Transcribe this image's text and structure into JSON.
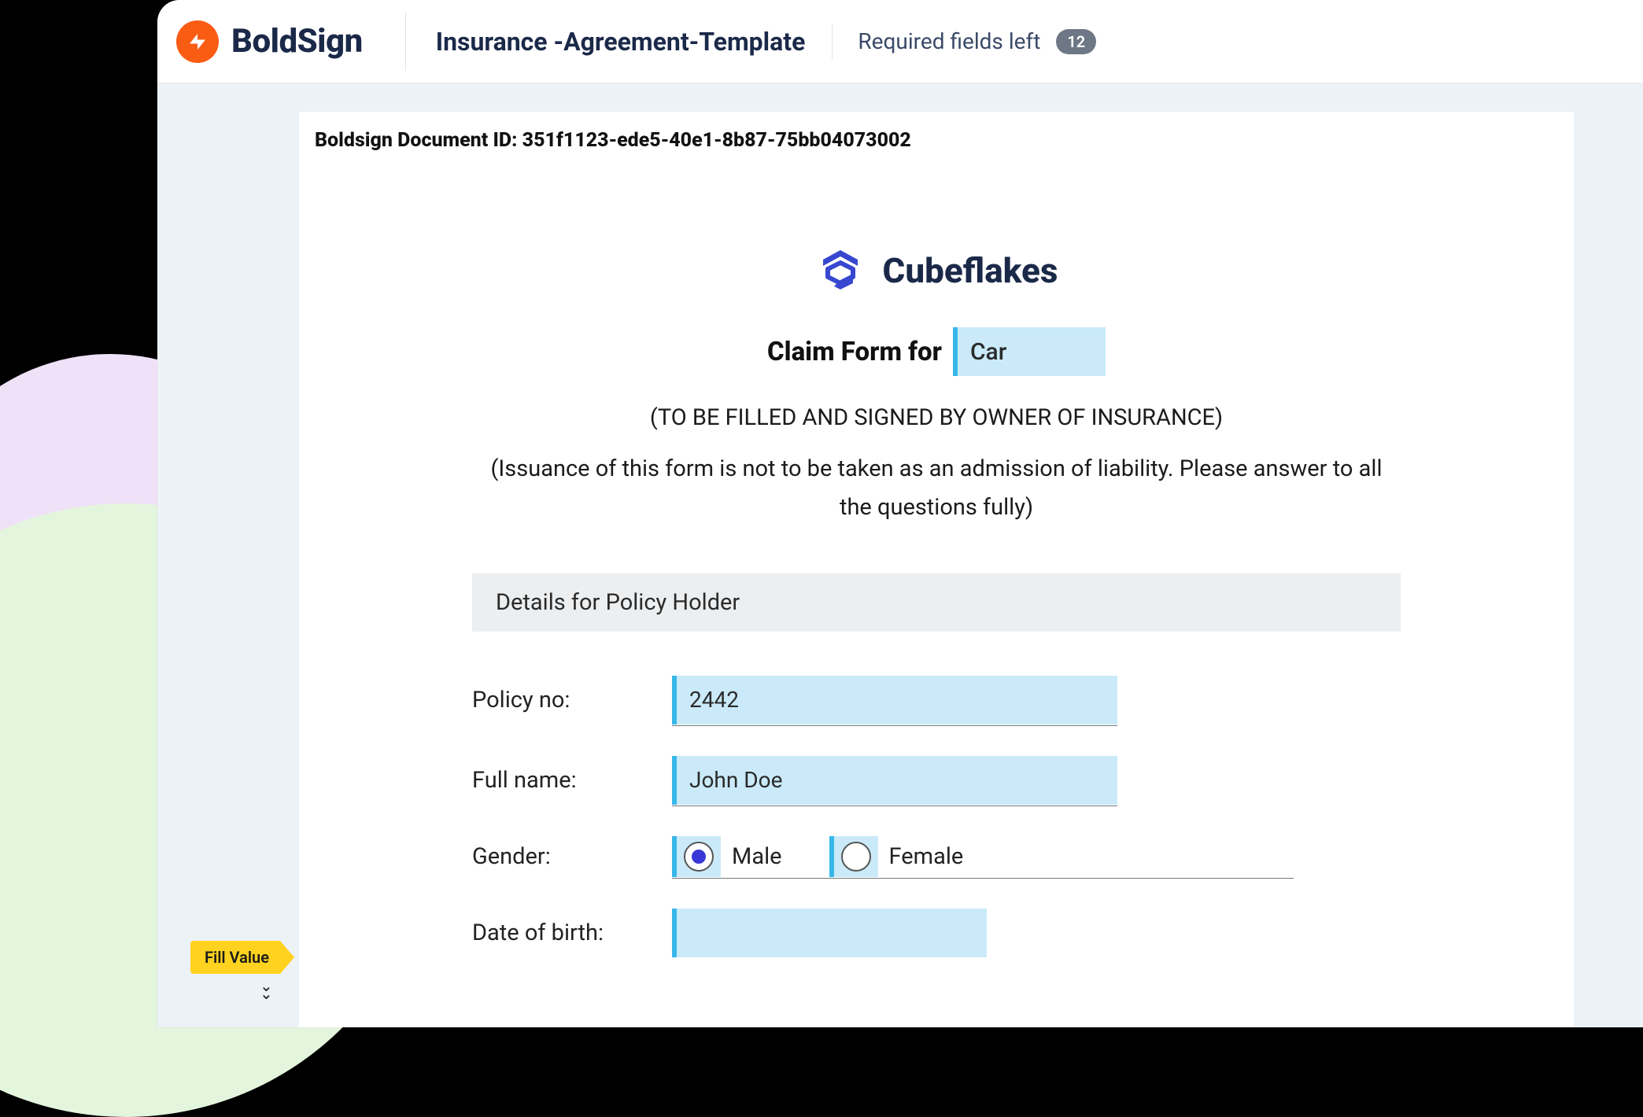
{
  "brand": {
    "name": "BoldSign"
  },
  "header": {
    "documentTitle": "Insurance -Agreement-Template",
    "requiredFieldsLabel": "Required fields left",
    "requiredFieldsCount": "12"
  },
  "document": {
    "idLabel": "Boldsign Document ID: 351f1123-ede5-40e1-8b87-75bb04073002",
    "company": "Cubeflakes",
    "claimFormLabel": "Claim Form for",
    "claimFormValue": "Car",
    "instruction1": "(TO BE FILLED AND SIGNED BY OWNER OF INSURANCE)",
    "instruction2": "(Issuance of this form is not to be taken as an admission of liability. Please answer to all the questions fully)",
    "sectionTitle": "Details for Policy Holder",
    "fields": {
      "policyNo": {
        "label": "Policy no:",
        "value": "2442"
      },
      "fullName": {
        "label": "Full name:",
        "value": "John Doe"
      },
      "gender": {
        "label": "Gender:",
        "options": {
          "male": "Male",
          "female": "Female"
        },
        "selected": "male"
      },
      "dob": {
        "label": "Date of birth:",
        "value": ""
      }
    }
  },
  "tag": {
    "label": "Fill Value"
  }
}
